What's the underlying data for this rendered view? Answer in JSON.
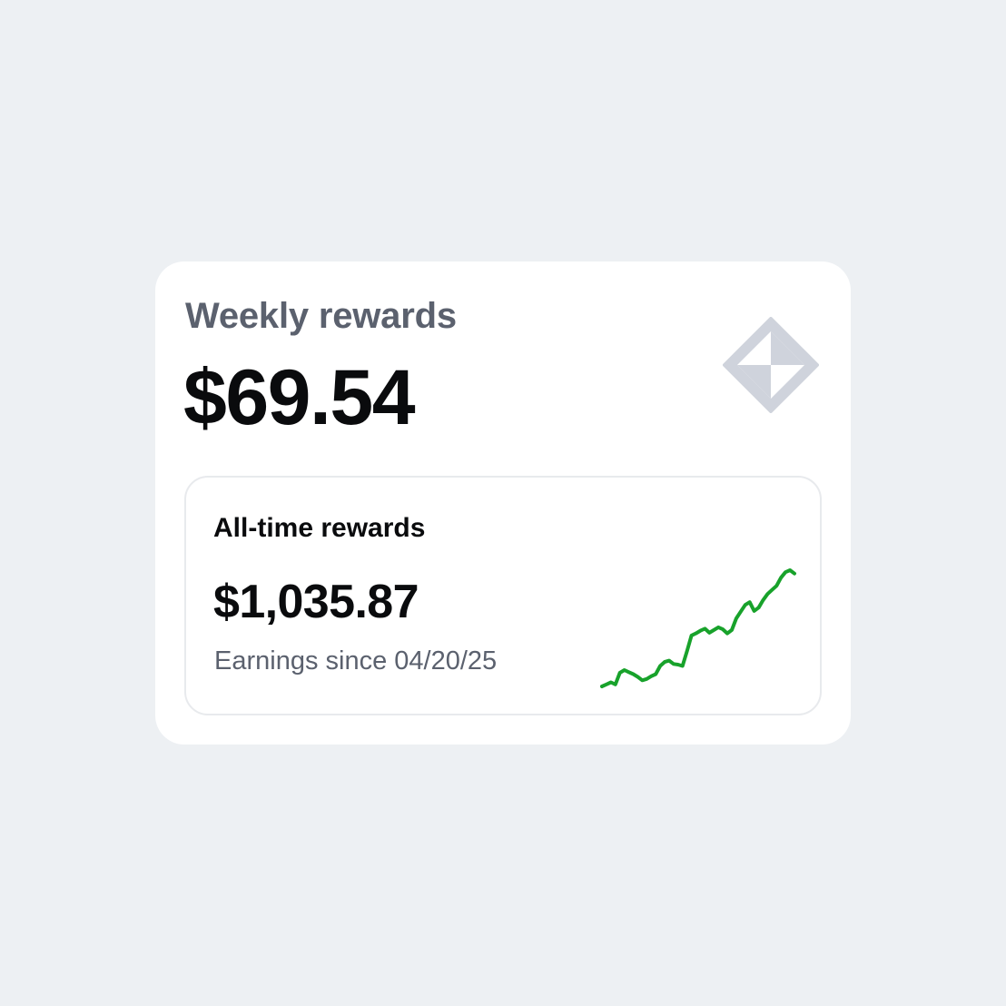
{
  "weekly": {
    "title": "Weekly rewards",
    "amount": "$69.54"
  },
  "logo": {
    "icon": "diamond-logo-icon",
    "color": "#cfd3dc"
  },
  "alltime": {
    "title": "All-time rewards",
    "amount": "$1,035.87",
    "since": "Earnings since 04/20/25"
  },
  "sparkline": {
    "color": "#18a22b",
    "values": [
      0,
      3,
      6,
      3,
      20,
      24,
      21,
      18,
      14,
      9,
      11,
      15,
      18,
      30,
      36,
      38,
      33,
      32,
      30,
      52,
      75,
      78,
      82,
      85,
      79,
      83,
      87,
      84,
      78,
      83,
      100,
      110,
      120,
      124,
      111,
      116,
      127,
      136,
      142,
      148,
      160,
      168,
      171,
      166
    ]
  }
}
